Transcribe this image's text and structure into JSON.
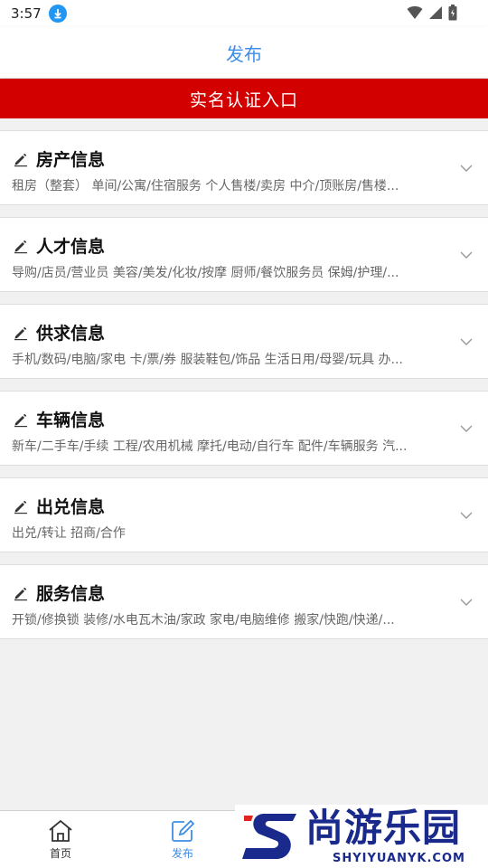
{
  "status_bar": {
    "time": "3:57"
  },
  "header": {
    "title": "发布"
  },
  "verify_banner": {
    "label": "实名认证入口"
  },
  "categories": [
    {
      "title": "房产信息",
      "desc": "租房（整套） 单间/公寓/住宿服务 个人售楼/卖房 中介/顶账房/售楼..."
    },
    {
      "title": "人才信息",
      "desc": "导购/店员/营业员 美容/美发/化妆/按摩 厨师/餐饮服务员 保姆/护理/..."
    },
    {
      "title": "供求信息",
      "desc": "手机/数码/电脑/家电 卡/票/券 服装鞋包/饰品 生活日用/母婴/玩具 办..."
    },
    {
      "title": "车辆信息",
      "desc": "新车/二手车/手续 工程/农用机械 摩托/电动/自行车 配件/车辆服务 汽..."
    },
    {
      "title": "出兑信息",
      "desc": "出兑/转让 招商/合作"
    },
    {
      "title": "服务信息",
      "desc": "开锁/修换锁 装修/水电瓦木油/家政 家电/电脑维修 搬家/快跑/快递/..."
    }
  ],
  "bottom_nav": {
    "home_label": "首页",
    "publish_label": "发布"
  },
  "watermark": {
    "chinese": "尚游乐园",
    "english": "SHYIYUANYK.COM"
  },
  "colors": {
    "accent": "#3d8ee6",
    "banner": "#d30000",
    "watermark": "#1a2a8c"
  }
}
